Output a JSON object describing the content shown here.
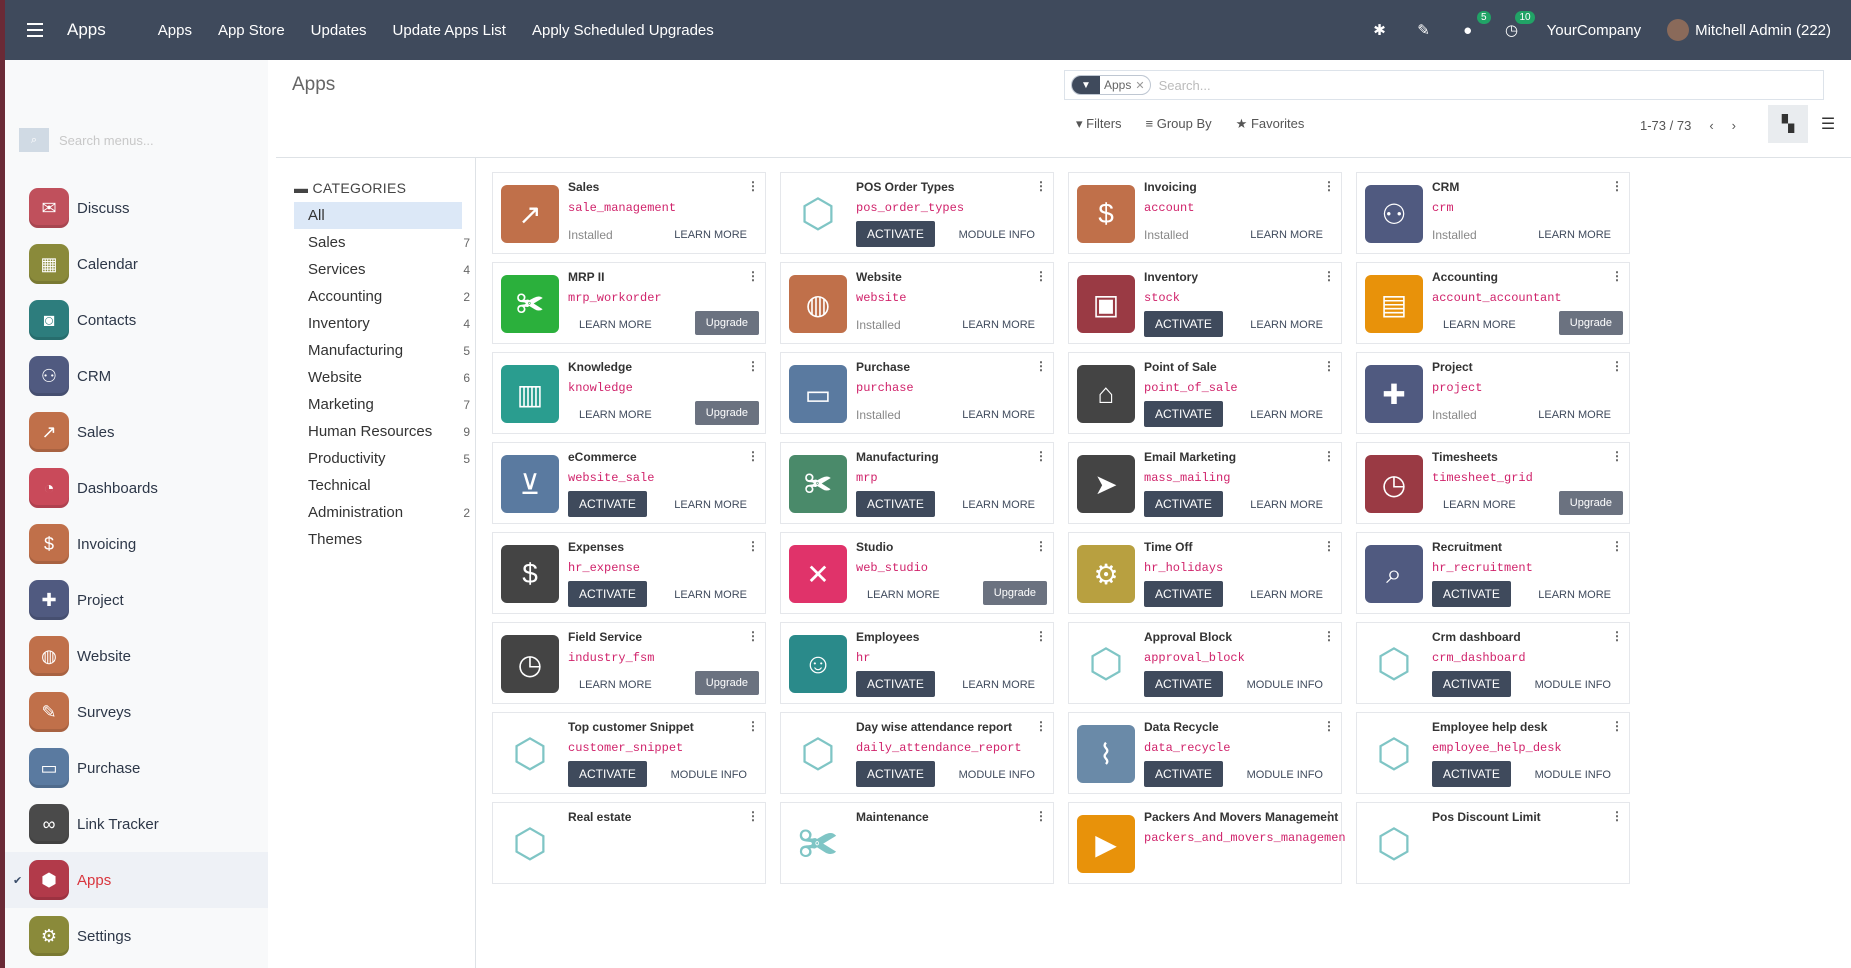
{
  "topbar": {
    "title": "Apps",
    "menu": [
      "Apps",
      "App Store",
      "Updates",
      "Update Apps List",
      "Apply Scheduled Upgrades"
    ],
    "chat_badge": "5",
    "activity_badge": "10",
    "company": "YourCompany",
    "user": "Mitchell Admin (222)"
  },
  "sidebar": {
    "search_placeholder": "Search menus...",
    "items": [
      {
        "label": "Discuss",
        "icon": "chat-icon",
        "color": "#c0505c"
      },
      {
        "label": "Calendar",
        "icon": "calendar-icon",
        "color": "#8a8a3a"
      },
      {
        "label": "Contacts",
        "icon": "contact-card-icon",
        "color": "#2d7d7d"
      },
      {
        "label": "CRM",
        "icon": "handshake-icon",
        "color": "#505a80"
      },
      {
        "label": "Sales",
        "icon": "chart-up-icon",
        "color": "#c0704a"
      },
      {
        "label": "Dashboards",
        "icon": "gauge-icon",
        "color": "#c94a5a"
      },
      {
        "label": "Invoicing",
        "icon": "invoice-icon",
        "color": "#c0704a"
      },
      {
        "label": "Project",
        "icon": "puzzle-icon",
        "color": "#505a80"
      },
      {
        "label": "Website",
        "icon": "globe-icon",
        "color": "#c0704a"
      },
      {
        "label": "Surveys",
        "icon": "survey-icon",
        "color": "#c0704a"
      },
      {
        "label": "Purchase",
        "icon": "credit-card-icon",
        "color": "#5a7aa0"
      },
      {
        "label": "Link Tracker",
        "icon": "link-icon",
        "color": "#4a4a4a"
      },
      {
        "label": "Apps",
        "icon": "cubes-icon",
        "color": "#b23a4a",
        "active": true
      },
      {
        "label": "Settings",
        "icon": "gear-icon",
        "color": "#8a8a3a"
      }
    ]
  },
  "main": {
    "title": "Apps",
    "facet": "Apps",
    "search_placeholder": "Search...",
    "filters_label": "Filters",
    "groupby_label": "Group By",
    "favorites_label": "Favorites",
    "pager": "1-73 / 73"
  },
  "categories": {
    "heading": "CATEGORIES",
    "items": [
      {
        "label": "All",
        "count": "",
        "selected": true
      },
      {
        "label": "Sales",
        "count": "7"
      },
      {
        "label": "Services",
        "count": "4"
      },
      {
        "label": "Accounting",
        "count": "2"
      },
      {
        "label": "Inventory",
        "count": "4"
      },
      {
        "label": "Manufacturing",
        "count": "5"
      },
      {
        "label": "Website",
        "count": "6"
      },
      {
        "label": "Marketing",
        "count": "7"
      },
      {
        "label": "Human Resources",
        "count": "9"
      },
      {
        "label": "Productivity",
        "count": "5"
      },
      {
        "label": "Technical",
        "count": ""
      },
      {
        "label": "Administration",
        "count": "2"
      },
      {
        "label": "Themes",
        "count": ""
      }
    ]
  },
  "labels": {
    "activate": "ACTIVATE",
    "learn_more": "LEARN MORE",
    "module_info": "MODULE INFO",
    "upgrade": "Upgrade",
    "installed": "Installed"
  },
  "apps": [
    {
      "name": "Sales",
      "tech": "sale_management",
      "icon": "chart-up-icon",
      "color": "#c0704a",
      "state": "installed",
      "link": "learn"
    },
    {
      "name": "POS Order Types",
      "tech": "pos_order_types",
      "icon": "cube-icon",
      "color": "",
      "state": "activate",
      "link": "info"
    },
    {
      "name": "Invoicing",
      "tech": "account",
      "icon": "invoice-icon",
      "color": "#c0704a",
      "state": "installed",
      "link": "learn"
    },
    {
      "name": "CRM",
      "tech": "crm",
      "icon": "handshake-icon",
      "color": "#505a80",
      "state": "installed",
      "link": "learn"
    },
    {
      "name": "MRP II",
      "tech": "mrp_workorder",
      "icon": "wrench-icon",
      "color": "#2bb03c",
      "state": "upgrade",
      "link": "learn"
    },
    {
      "name": "Website",
      "tech": "website",
      "icon": "globe-icon",
      "color": "#c0704a",
      "state": "installed",
      "link": "learn"
    },
    {
      "name": "Inventory",
      "tech": "stock",
      "icon": "box-icon",
      "color": "#9a3a44",
      "state": "activate",
      "link": "learn"
    },
    {
      "name": "Accounting",
      "tech": "account_accountant",
      "icon": "document-icon",
      "color": "#e8920a",
      "state": "upgrade",
      "link": "learn"
    },
    {
      "name": "Knowledge",
      "tech": "knowledge",
      "icon": "book-icon",
      "color": "#2a9d8f",
      "state": "upgrade",
      "link": "learn"
    },
    {
      "name": "Purchase",
      "tech": "purchase",
      "icon": "credit-card-icon",
      "color": "#5a7aa0",
      "state": "installed",
      "link": "learn"
    },
    {
      "name": "Point of Sale",
      "tech": "point_of_sale",
      "icon": "store-icon",
      "color": "#444444",
      "state": "activate",
      "link": "learn"
    },
    {
      "name": "Project",
      "tech": "project",
      "icon": "puzzle-icon",
      "color": "#505a80",
      "state": "installed",
      "link": "learn"
    },
    {
      "name": "eCommerce",
      "tech": "website_sale",
      "icon": "cart-icon",
      "color": "#5a7aa0",
      "state": "activate",
      "link": "learn"
    },
    {
      "name": "Manufacturing",
      "tech": "mrp",
      "icon": "wrench-icon",
      "color": "#4a8a6a",
      "state": "activate",
      "link": "learn"
    },
    {
      "name": "Email Marketing",
      "tech": "mass_mailing",
      "icon": "paper-plane-icon",
      "color": "#444444",
      "state": "activate",
      "link": "learn"
    },
    {
      "name": "Timesheets",
      "tech": "timesheet_grid",
      "icon": "stopwatch-icon",
      "color": "#9a3a44",
      "state": "upgrade",
      "link": "learn"
    },
    {
      "name": "Expenses",
      "tech": "hr_expense",
      "icon": "user-dollar-icon",
      "color": "#444444",
      "state": "activate",
      "link": "learn"
    },
    {
      "name": "Studio",
      "tech": "web_studio",
      "icon": "tools-icon",
      "color": "#e0336a",
      "state": "upgrade",
      "link": "learn"
    },
    {
      "name": "Time Off",
      "tech": "hr_holidays",
      "icon": "user-gear-icon",
      "color": "#b8a040",
      "state": "activate",
      "link": "learn"
    },
    {
      "name": "Recruitment",
      "tech": "hr_recruitment",
      "icon": "magnifier-icon",
      "color": "#505a80",
      "state": "activate",
      "link": "learn"
    },
    {
      "name": "Field Service",
      "tech": "industry_fsm",
      "icon": "puzzle-clock-icon",
      "color": "#444444",
      "state": "upgrade",
      "link": "learn"
    },
    {
      "name": "Employees",
      "tech": "hr",
      "icon": "people-icon",
      "color": "#2a8a8a",
      "state": "activate",
      "link": "learn"
    },
    {
      "name": "Approval Block",
      "tech": "approval_block",
      "icon": "cube-icon",
      "color": "",
      "state": "activate",
      "link": "info"
    },
    {
      "name": "Crm dashboard",
      "tech": "crm_dashboard",
      "icon": "cube-icon",
      "color": "",
      "state": "activate",
      "link": "info"
    },
    {
      "name": "Top customer Snippet",
      "tech": "customer_snippet",
      "icon": "cube-icon",
      "color": "",
      "state": "activate",
      "link": "info"
    },
    {
      "name": "Day wise attendance report",
      "tech": "daily_attendance_report",
      "icon": "cube-icon",
      "color": "",
      "state": "activate",
      "link": "info"
    },
    {
      "name": "Data Recycle",
      "tech": "data_recycle",
      "icon": "broom-icon",
      "color": "#6a8aa8",
      "state": "activate",
      "link": "info"
    },
    {
      "name": "Employee help desk",
      "tech": "employee_help_desk",
      "icon": "cube-icon",
      "color": "",
      "state": "activate",
      "link": "info"
    },
    {
      "name": "Real estate",
      "tech": "",
      "icon": "cube-icon",
      "color": "",
      "state": "none",
      "link": "none"
    },
    {
      "name": "Maintenance",
      "tech": "",
      "icon": "wrench-icon",
      "color": "",
      "state": "none",
      "link": "none"
    },
    {
      "name": "Packers And Movers Management",
      "tech": "packers_and_movers_managemen",
      "icon": "truck-icon",
      "color": "#e8920a",
      "state": "none",
      "link": "none"
    },
    {
      "name": "Pos Discount Limit",
      "tech": "",
      "icon": "cube-icon",
      "color": "",
      "state": "none",
      "link": "none"
    }
  ]
}
